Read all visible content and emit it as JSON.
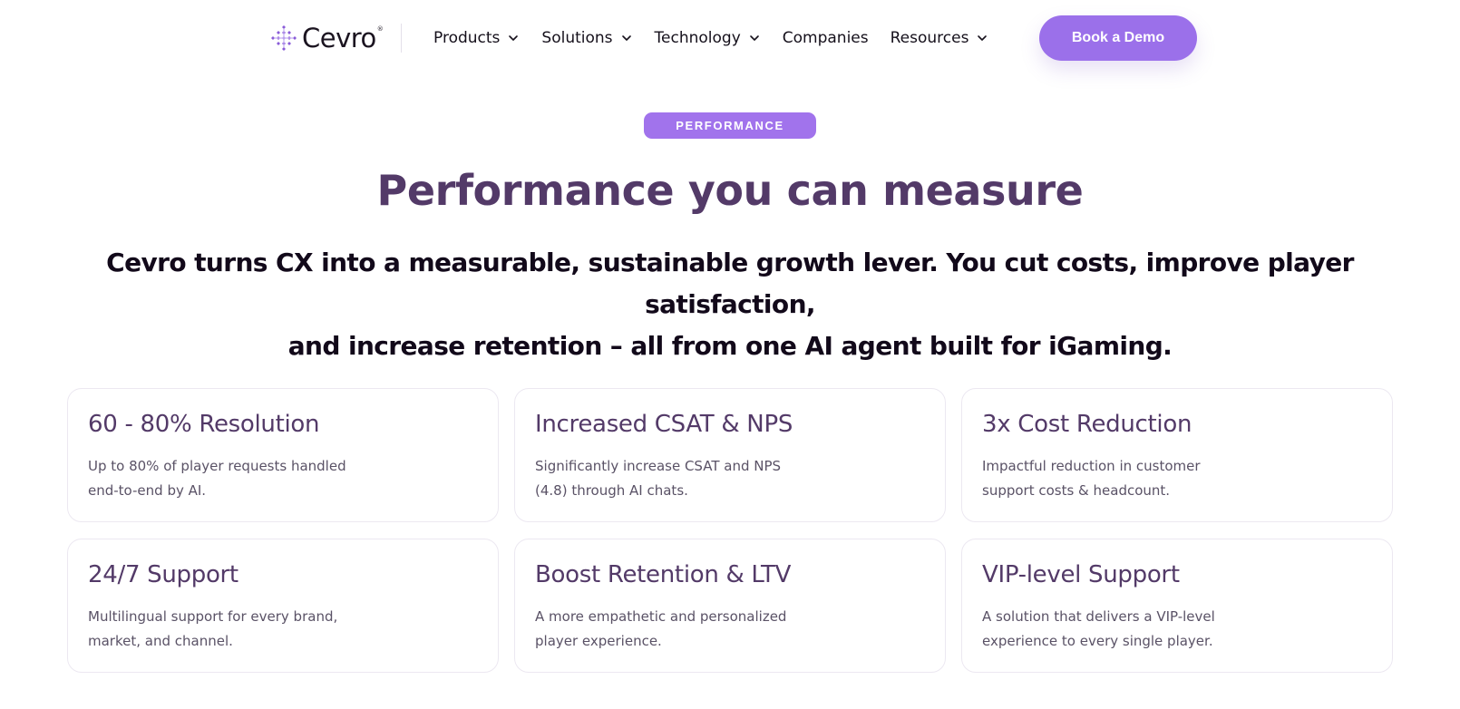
{
  "brand": {
    "name": "Cevro",
    "trademark": "®",
    "accent_color": "#9b70ea",
    "heading_color": "#533a68"
  },
  "nav": {
    "items": [
      {
        "label": "Products",
        "has_dropdown": true
      },
      {
        "label": "Solutions",
        "has_dropdown": true
      },
      {
        "label": "Technology",
        "has_dropdown": true
      },
      {
        "label": "Companies",
        "has_dropdown": false
      },
      {
        "label": "Resources",
        "has_dropdown": true
      }
    ],
    "cta_label": "Book a Demo"
  },
  "hero": {
    "badge": "PERFORMANCE",
    "title": "Performance you can measure",
    "subtitle_line1": "Cevro turns CX into a measurable, sustainable growth lever. You cut costs, improve player satisfaction,",
    "subtitle_line2": "and increase retention – all from one AI agent built for iGaming."
  },
  "cards": [
    {
      "title": "60 - 80% Resolution",
      "desc_line1": "Up to 80% of player requests handled",
      "desc_line2": "end-to-end by AI."
    },
    {
      "title": "Increased CSAT & NPS",
      "desc_line1": "Significantly increase CSAT and NPS",
      "desc_line2": "(4.8) through AI chats."
    },
    {
      "title": "3x Cost Reduction",
      "desc_line1": "Impactful reduction in customer",
      "desc_line2": "support costs & headcount."
    },
    {
      "title": "24/7 Support",
      "desc_line1": "Multilingual support for every brand,",
      "desc_line2": "market, and channel."
    },
    {
      "title": "Boost Retention & LTV",
      "desc_line1": "A more empathetic and personalized",
      "desc_line2": "player experience."
    },
    {
      "title": "VIP-level Support",
      "desc_line1": "A solution that delivers a VIP-level",
      "desc_line2": "experience to every single player."
    }
  ]
}
